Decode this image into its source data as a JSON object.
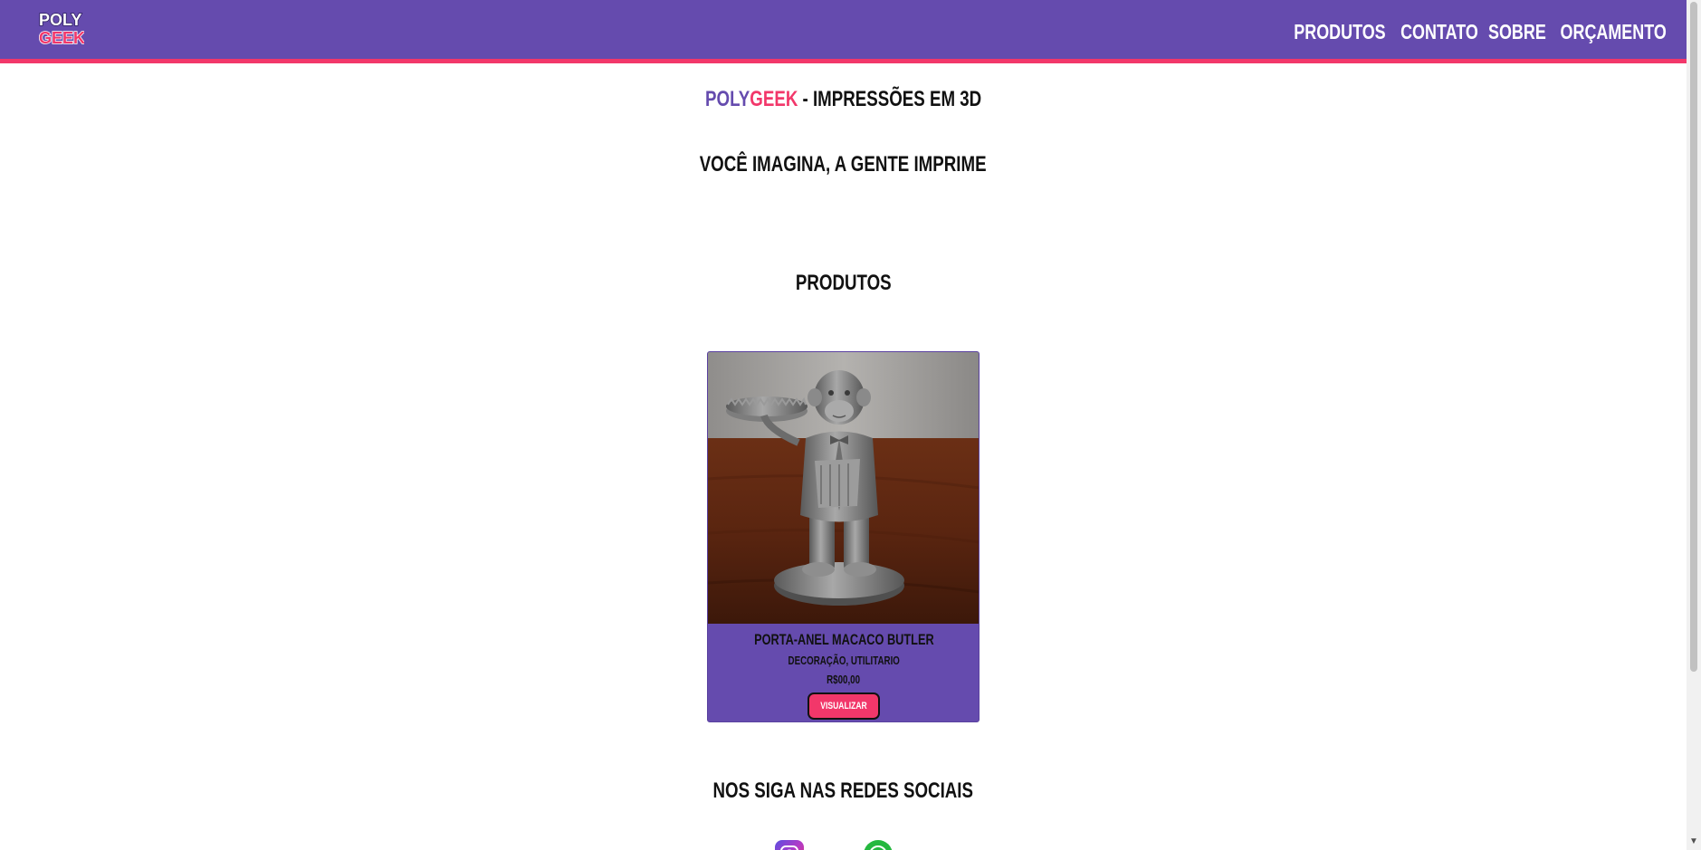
{
  "nav": {
    "logo_alt": "PolyGeek",
    "logo_line1": "POLY",
    "logo_line2": "GEEK",
    "links": [
      "PRODUTOS",
      "CONTATO",
      "SOBRE",
      "ORÇAMENTO"
    ]
  },
  "hero": {
    "brand_part1": "POLY",
    "brand_part2": "GEEK",
    "title_rest": " - IMPRESSÕES EM 3D",
    "tagline": "VOCÊ IMAGINA, A GENTE IMPRIME"
  },
  "products": {
    "section_title": "PRODUTOS",
    "items": [
      {
        "name": "PORTA-ANEL MACACO BUTLER",
        "tags": "DECORAÇÃO, UTILITARIO",
        "price": "R$00,00",
        "button_label": "VISUALIZAR",
        "image_description": "Gray 3D-printed monkey butler figure holding a tray on a wooden table"
      }
    ]
  },
  "social": {
    "title": "NOS SIGA NAS REDES SOCIAIS",
    "icons": [
      "instagram-icon",
      "whatsapp-icon"
    ]
  },
  "colors": {
    "primary": "#654bae",
    "accent": "#f2376a"
  }
}
